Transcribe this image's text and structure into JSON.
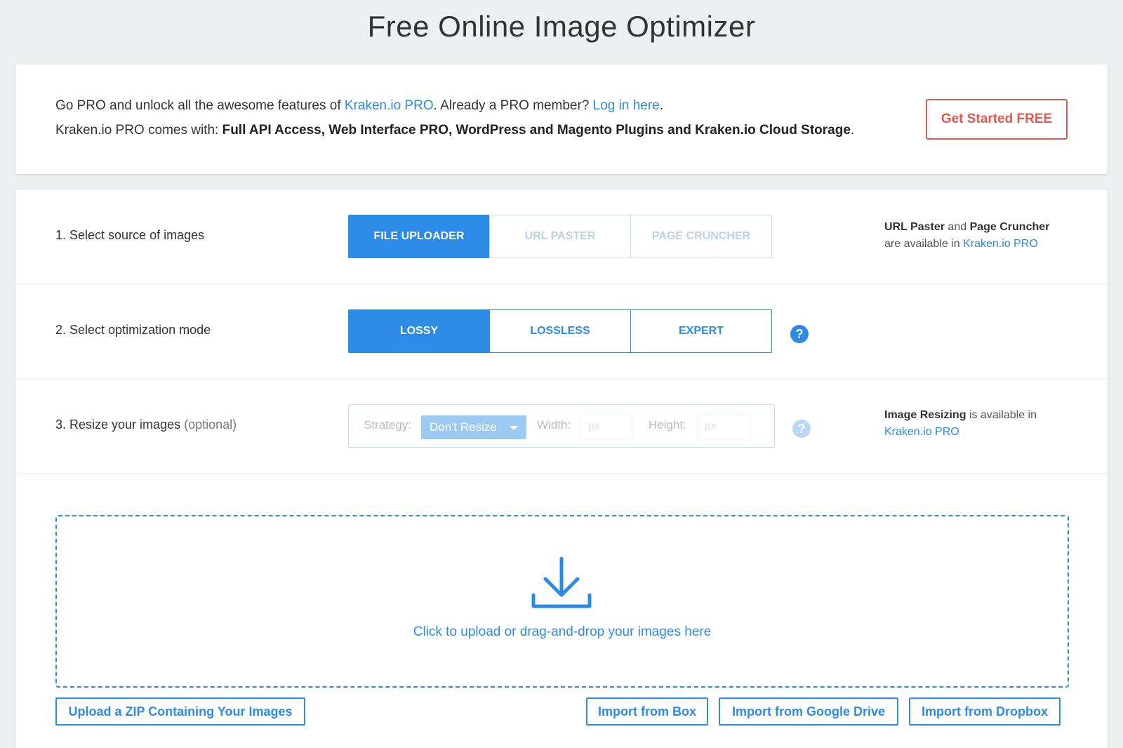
{
  "page": {
    "title": "Free Online Image Optimizer"
  },
  "promo": {
    "line1_prefix": "Go PRO and unlock all the awesome features of ",
    "line1_link": "Kraken.io PRO",
    "line1_mid": ". Already a PRO member? ",
    "line1_login": "Log in here",
    "line1_end": ".",
    "line2_prefix": "Kraken.io PRO comes with: ",
    "line2_bold": "Full API Access, Web Interface PRO, WordPress and Magento Plugins and Kraken.io Cloud Storage",
    "line2_end": ".",
    "cta_label": "Get Started FREE"
  },
  "source": {
    "label": "1. Select source of images",
    "options": [
      "FILE UPLOADER",
      "URL PASTER",
      "PAGE CRUNCHER"
    ],
    "selected": "FILE UPLOADER",
    "note_bold1": "URL Paster",
    "note_and": " and ",
    "note_bold2": "Page Cruncher",
    "note_line2": "are available in ",
    "note_link": "Kraken.io PRO"
  },
  "mode": {
    "label": "2. Select optimization mode",
    "options": [
      "LOSSY",
      "LOSSLESS",
      "EXPERT"
    ],
    "selected": "LOSSY",
    "help_glyph": "?"
  },
  "resize": {
    "label": "3. Resize your images",
    "optional": "(optional)",
    "strategy_label": "Strategy:",
    "strategy_value": "Don't Resize",
    "width_label": "Width:",
    "width_placeholder": "px",
    "height_label": "Height:",
    "height_placeholder": "px",
    "help_glyph": "?",
    "note_bold": "Image Resizing",
    "note_text": " is available in",
    "note_link": "Kraken.io PRO"
  },
  "upload": {
    "icon": "download-icon",
    "text": "Click to upload or drag-and-drop your images here",
    "zip_button": "Upload a ZIP Containing Your Images",
    "box_button": "Import from Box",
    "gdrive_button": "Import from Google Drive",
    "dropbox_button": "Import from Dropbox"
  },
  "colors": {
    "accent": "#2b8be6",
    "cta": "#e05a4e",
    "background": "#edf0f0"
  }
}
